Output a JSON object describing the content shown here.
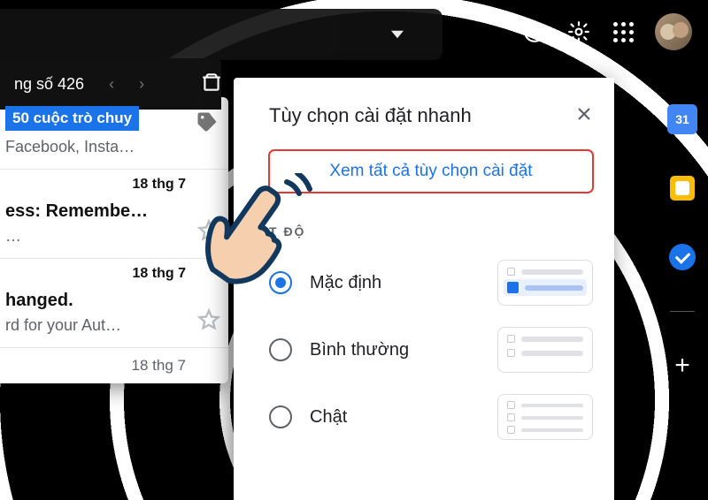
{
  "header": {
    "help_icon": "help-icon",
    "settings_icon": "gear-icon",
    "apps_icon": "apps-grid-icon",
    "avatar": "user-avatar"
  },
  "inbox": {
    "pagination_label": "ng số 426",
    "rows": [
      {
        "chip": "50 cuộc trò chuy",
        "subtitle": "Facebook, Insta…"
      },
      {
        "date": "18 thg 7",
        "title": "ess: Remembe…",
        "subtitle": "…"
      },
      {
        "date": "18 thg 7",
        "title": "hanged.",
        "subtitle": "rd for your Aut…"
      }
    ],
    "bottom_date": "18 thg 7"
  },
  "panel": {
    "title": "Tùy chọn cài đặt nhanh",
    "see_all_label": "Xem tất cả tùy chọn cài đặt",
    "section_label": "T ĐỘ",
    "density": [
      {
        "label": "Mặc định",
        "selected": true
      },
      {
        "label": "Bình thường",
        "selected": false
      },
      {
        "label": "Chật",
        "selected": false
      }
    ]
  },
  "side_rail": {
    "calendar_day": "31"
  }
}
